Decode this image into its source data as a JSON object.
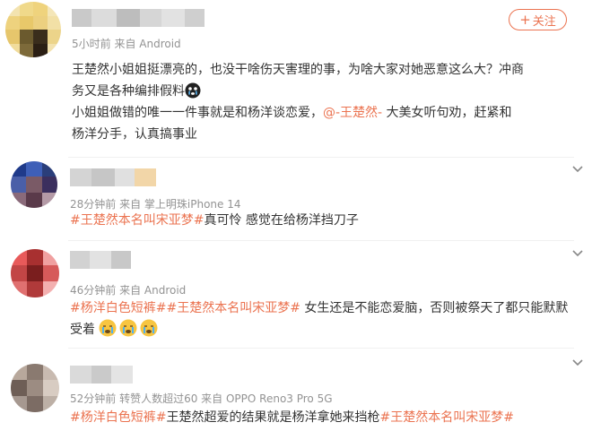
{
  "main_post": {
    "meta": "5小时前 来自 Android",
    "follow_label": "关注",
    "text_line1": "王楚然小姐姐挺漂亮的，也没干啥伤天害理的事，为啥大家对她恶意这么大？冲商",
    "text_line2": "务又是各种编排假料",
    "text_line3": "小姐姐做错的唯一一件事就是和杨洋谈恋爱，",
    "mention": "@-王楚然-",
    "text_line3b": " 大美女听句劝，赶紧和",
    "text_line4": "杨洋分手，认真搞事业",
    "emoji_icon": "crying-face-icon"
  },
  "comments": [
    {
      "meta": "28分钟前 来自 掌上明珠iPhone 14",
      "hashtags": [
        "#王楚然本名叫宋亚梦#"
      ],
      "text": "真可怜 感觉在给杨洋挡刀子"
    },
    {
      "meta": "46分钟前 来自 Android",
      "hashtags": [
        "#杨洋白色短裤#",
        "#王楚然本名叫宋亚梦#"
      ],
      "text": " 女生还是不能恋爱脑，否则被祭天了都只能默默",
      "text2": "受着",
      "emoji_icon": "sobbing-face-icon"
    },
    {
      "meta": "52分钟前 转赞人数超过60 来自 OPPO Reno3 Pro 5G",
      "hashtags_pre": "#杨洋白色短裤#",
      "text": "王楚然超爱的结果就是杨洋拿她来挡枪",
      "hashtags_post": "#王楚然本名叫宋亚梦#"
    }
  ],
  "colors": {
    "accent": "#eb7350",
    "meta": "#939393",
    "text": "#333333"
  }
}
